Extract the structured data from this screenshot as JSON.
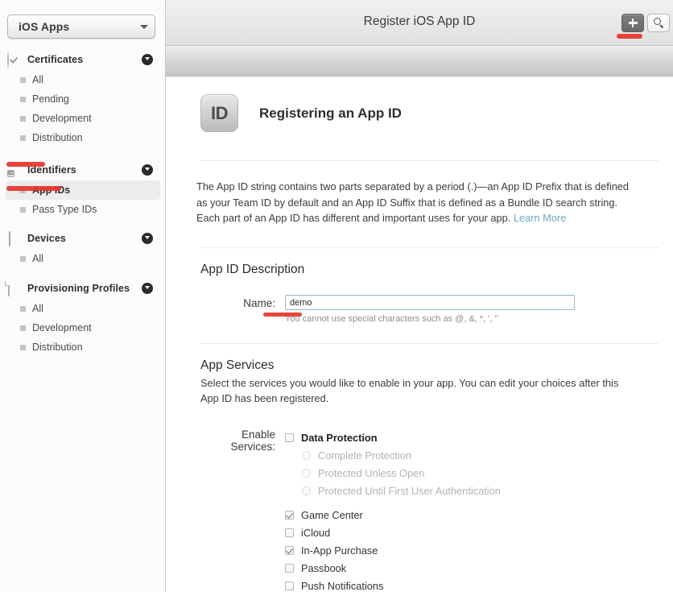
{
  "sidebar": {
    "org_select": {
      "value": "iOS Apps",
      "arrow_icon": "chevron-down-icon"
    },
    "groups": [
      {
        "title": "Certificates",
        "icon": "seal-check-icon",
        "disclosure_icon": "chevron-down-circle-icon",
        "items": [
          "All",
          "Pending",
          "Development",
          "Distribution"
        ]
      },
      {
        "title": "Identifiers",
        "icon": "id-badge-icon",
        "icon_text": "ID",
        "disclosure_icon": "chevron-down-circle-icon",
        "items": [
          "App IDs",
          "Pass Type IDs"
        ],
        "selected": "App IDs"
      },
      {
        "title": "Devices",
        "icon": "phone-icon",
        "disclosure_icon": "chevron-down-circle-icon",
        "items": [
          "All"
        ]
      },
      {
        "title": "Provisioning Profiles",
        "icon": "document-icon",
        "disclosure_icon": "chevron-down-circle-icon",
        "items": [
          "All",
          "Development",
          "Distribution"
        ]
      }
    ]
  },
  "titlebar": {
    "title": "Register iOS App ID",
    "add_button": {
      "name": "add-button",
      "icon": "plus-icon",
      "state": "pressed"
    },
    "search_button": {
      "name": "search-button",
      "icon": "search-icon"
    }
  },
  "page": {
    "icon_text": "ID",
    "heading": "Registering an App ID",
    "intro": "The App ID string contains two parts separated by a period (.)—an App ID Prefix that is defined as your Team ID by default and an App ID Suffix that is defined as a Bundle ID search string. Each part of an App ID has different and important uses for your app. ",
    "intro_link": "Learn More"
  },
  "app_id_description": {
    "section_title": "App ID Description",
    "name_label": "Name:",
    "name_value": "demo",
    "name_placeholder": "",
    "name_hint": "You cannot use special characters such as @, &, *, ', \""
  },
  "app_services": {
    "section_title": "App Services",
    "section_sub": "Select the services you would like to enable in your app. You can edit your choices after this App ID has been registered.",
    "enable_label": "Enable Services:",
    "items": [
      {
        "label": "Data Protection",
        "type": "checkbox",
        "checked": false,
        "bold": true
      },
      {
        "label": "Complete Protection",
        "type": "radio",
        "checked": false,
        "disabled": true
      },
      {
        "label": "Protected Unless Open",
        "type": "radio",
        "checked": false,
        "disabled": true
      },
      {
        "label": "Protected Until First User Authentication",
        "type": "radio",
        "checked": false,
        "disabled": true
      },
      {
        "label": "Game Center",
        "type": "checkbox",
        "checked": true,
        "bold": false
      },
      {
        "label": "iCloud",
        "type": "checkbox",
        "checked": false,
        "bold": false
      },
      {
        "label": "In-App Purchase",
        "type": "checkbox",
        "checked": true,
        "bold": false
      },
      {
        "label": "Passbook",
        "type": "checkbox",
        "checked": false,
        "bold": false
      },
      {
        "label": "Push Notifications",
        "type": "checkbox",
        "checked": false,
        "bold": false
      }
    ]
  },
  "annotations": {
    "color": "#e8332a",
    "marks": [
      "underline-identifiers",
      "underline-app-ids",
      "underline-name-label",
      "underline-add-button"
    ]
  }
}
